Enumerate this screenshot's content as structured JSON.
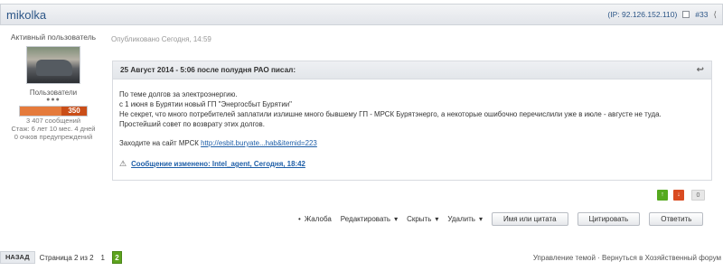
{
  "header": {
    "username": "mikolka",
    "ip_text": "(IP: 92.126.152.110)",
    "post_number": "#33"
  },
  "author": {
    "role": "Активный пользователь",
    "group": "Пользователи",
    "group_level_dots": "●●●",
    "reputation": "350",
    "messages": "3 407 сообщений",
    "tenure": "Стаж: 6 лет 10 мес. 4 дней",
    "warnings": "0 очков предупреждений"
  },
  "post": {
    "published": "Опубликовано Сегодня, 14:59"
  },
  "quote": {
    "header": "25 Август 2014 - 5:06 после полудня РАО писал:",
    "lines": [
      "По теме долгов  за электроэнергию.",
      "с 1 июня в Бурятии новый ГП \"Энергосбыт Бурятии\"",
      "Не секрет, что много потребителей заплатили излишне много бывшему ГП - МРСК  Бурятэнерго, а некоторые ошибочно перечислили уже в июле - августе не туда.",
      "Простейший совет по возврату этих долгов."
    ],
    "site_text": "Заходите на сайт МРСК",
    "site_link": "http://esbit.buryate...hab&itemid=223",
    "edited_text": "Сообщение изменено: Intel_agent, Сегодня, 18:42"
  },
  "votes": {
    "up": "↑",
    "down": "↓",
    "score": "0"
  },
  "actions": {
    "complaint": "Жалоба",
    "edit": "Редактировать",
    "hide": "Скрыть",
    "delete": "Удалить",
    "name_quote": "Имя или цитата",
    "quote": "Цитировать",
    "reply": "Ответить"
  },
  "footer": {
    "back": "НАЗАД",
    "page_status": "Страница 2 из 2",
    "page_1": "1",
    "page_2": "2",
    "right_text": "Управление темой · Вернуться в Хозяйственный форум"
  },
  "icons": {
    "share": "share-icon",
    "return": "return-icon",
    "warning": "warning-icon",
    "arrow_down": "dropdown-arrow-icon"
  },
  "colors": {
    "brand_blue": "#2c5687",
    "reputation": "#ca4e18",
    "current_page": "#5da31d"
  }
}
